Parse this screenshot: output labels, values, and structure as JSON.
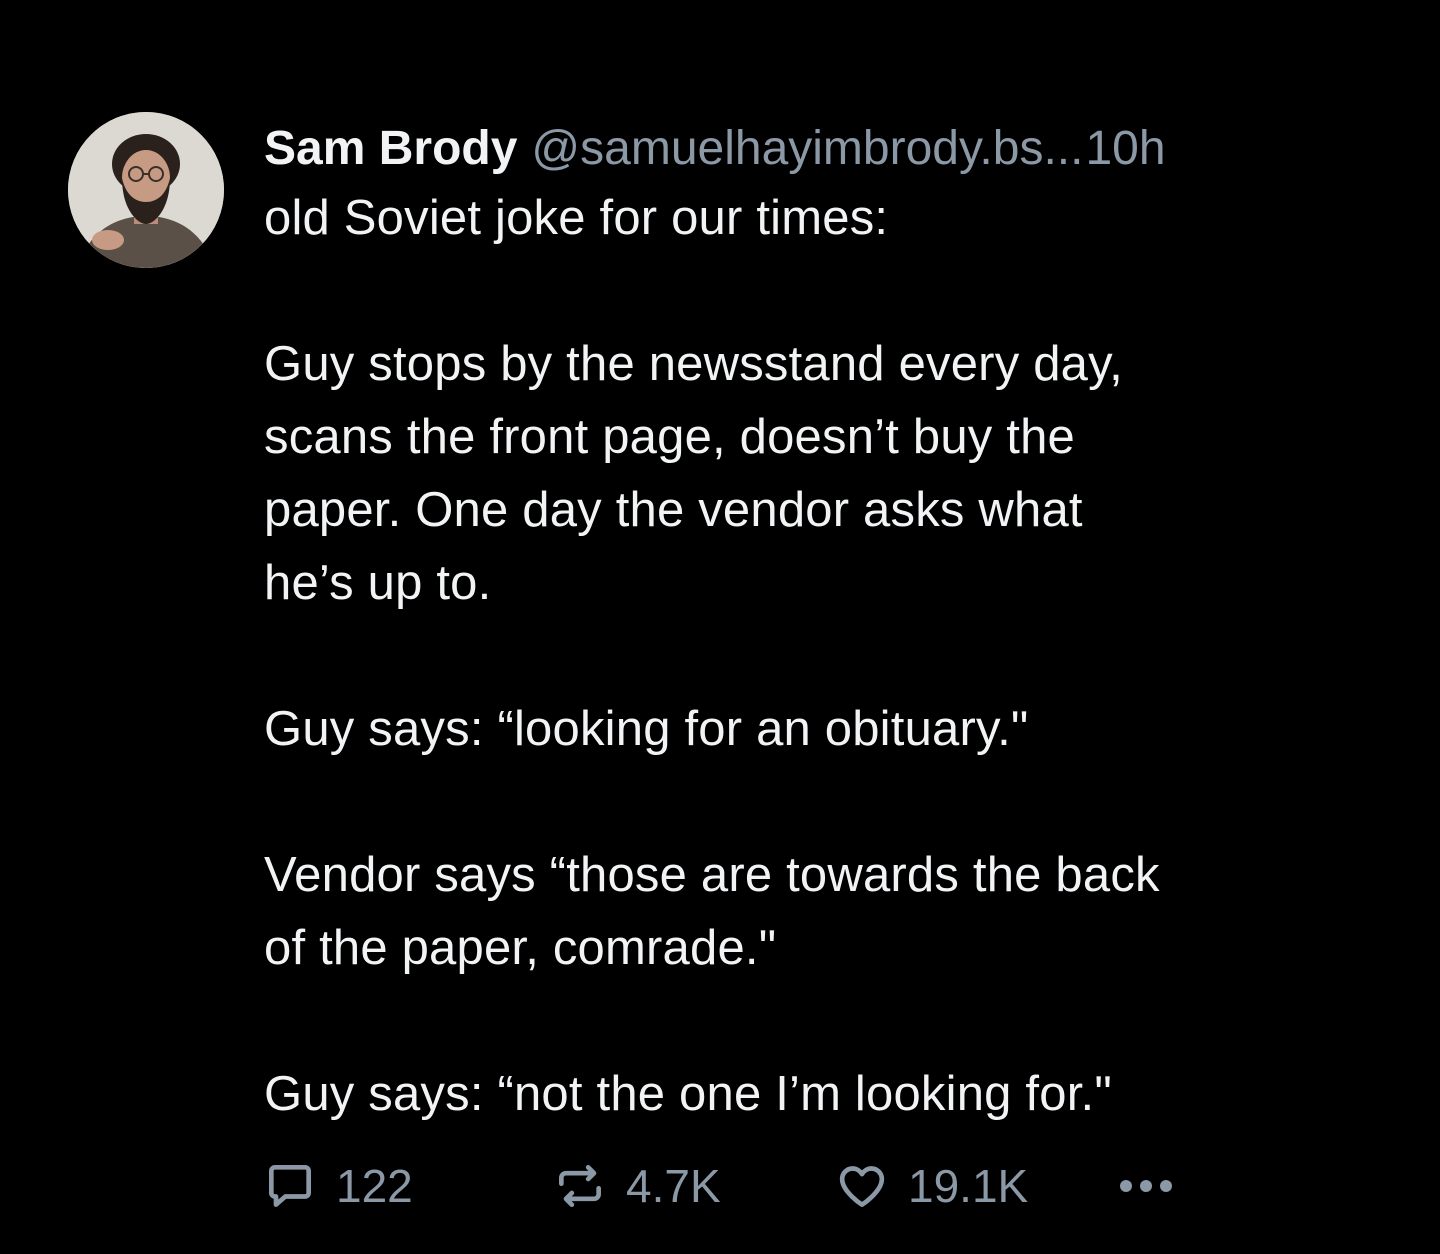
{
  "post": {
    "author": {
      "display_name": "Sam Brody",
      "handle": "@samuelhayimbrody.bs...",
      "timestamp": "10h"
    },
    "body": {
      "paragraphs": [
        {
          "lines": [
            "old Soviet joke for our times:"
          ]
        },
        {
          "lines": [
            "Guy stops by the newsstand every day,",
            "scans the front page, doesn’t buy the",
            "paper. One day the vendor asks what",
            "he’s up to."
          ]
        },
        {
          "lines": [
            "Guy says: “looking for an obituary.\""
          ]
        },
        {
          "lines": [
            "Vendor says “those are towards the back",
            "of the paper, comrade.\""
          ]
        },
        {
          "lines": [
            "Guy says: “not the one I’m looking for.\""
          ]
        }
      ]
    },
    "actions": {
      "reply": {
        "icon": "reply-icon",
        "count": "122"
      },
      "repost": {
        "icon": "repost-icon",
        "count": "4.7K"
      },
      "like": {
        "icon": "heart-icon",
        "count": "19.1K"
      },
      "more": {
        "icon": "more-icon"
      }
    }
  },
  "colors": {
    "background": "#000000",
    "text": "#f1f3f5",
    "muted": "#8b98a5"
  }
}
